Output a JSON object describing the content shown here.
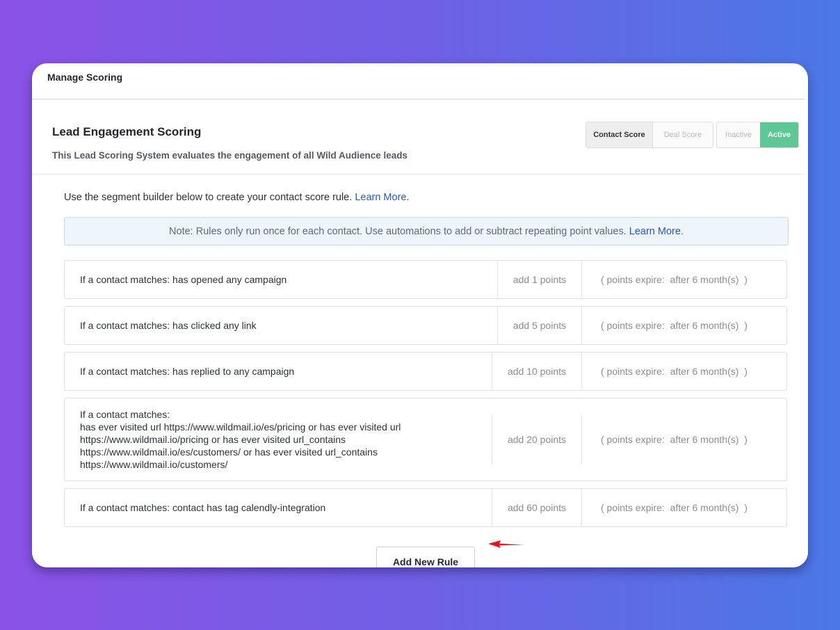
{
  "header": {
    "title": "Manage Scoring"
  },
  "system": {
    "title": "Lead Engagement Scoring",
    "description": "This Lead Scoring System evaluates the engagement of all Wild Audience leads"
  },
  "score_type_toggle": {
    "options": [
      "Contact Score",
      "Deal Score"
    ],
    "selected": "Contact Score"
  },
  "status_toggle": {
    "options": [
      "Inactive",
      "Active"
    ],
    "selected": "Active",
    "active_color": "#5ec894"
  },
  "intro": {
    "text": "Use the segment builder below to create your contact score rule. ",
    "link": "Learn More",
    "suffix": "."
  },
  "note": {
    "text": "Note: Rules only run once for each contact. Use automations to add or subtract repeating point values. ",
    "link": "Learn More",
    "suffix": "."
  },
  "rules": [
    {
      "condition": "If a contact matches: has opened any campaign",
      "points": "add 1 points",
      "expire": "( points expire:  after 6 month(s)  )"
    },
    {
      "condition": "If a contact matches: has clicked any link",
      "points": "add 5 points",
      "expire": "( points expire:  after 6 month(s)  )"
    },
    {
      "condition": "If a contact matches: has replied to any campaign",
      "points": "add 10 points",
      "expire": "( points expire:  after 6 month(s)  )"
    },
    {
      "condition_label": "If a contact matches:",
      "condition": "has ever visited url https://www.wildmail.io/es/pricing or has ever visited url https://www.wildmail.io/pricing or has ever visited url_contains https://www.wildmail.io/es/customers/ or has ever visited url_contains https://www.wildmail.io/customers/",
      "points": "add 20 points",
      "expire": "( points expire:  after 6 month(s)  )"
    },
    {
      "condition": "If a contact matches: contact has tag calendly-integration",
      "points": "add 60 points",
      "expire": "( points expire:  after 6 month(s)  )"
    }
  ],
  "actions": {
    "add_rule": "Add New Rule"
  },
  "colors": {
    "link": "#2456d6",
    "annotation_arrow": "#e8161b"
  }
}
